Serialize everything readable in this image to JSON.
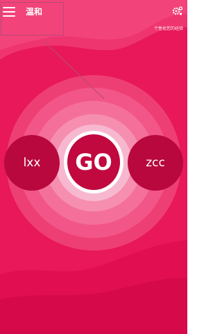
{
  "header": {
    "title": "温和",
    "menu_icon": "hamburger-menu-icon",
    "settings_icon": "gear-icon",
    "tooltip": "个性化您的经验"
  },
  "main": {
    "left_player": "lxx",
    "go_label": "GO",
    "right_player": "zcc"
  },
  "colors": {
    "background": "#e8185a",
    "button": "#b8083e",
    "ring_outer": "#ee3f74",
    "ring_inner": "#f7b8cf"
  }
}
